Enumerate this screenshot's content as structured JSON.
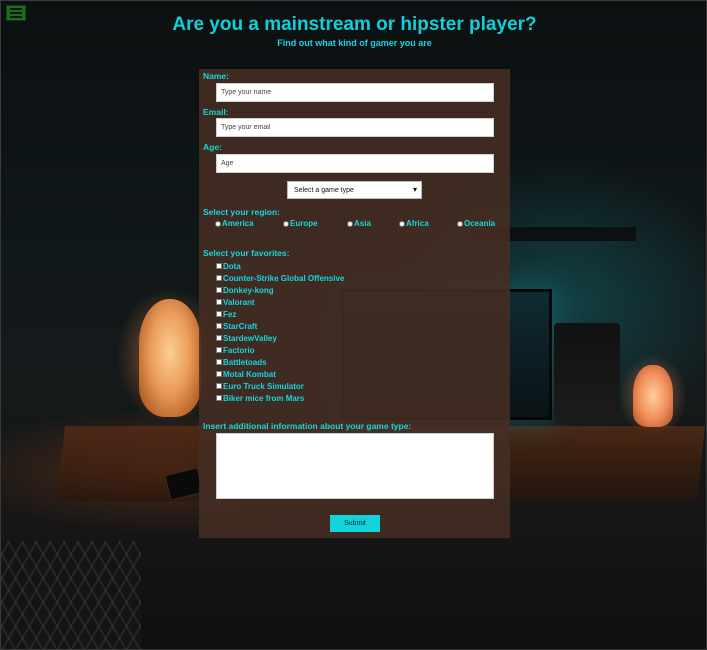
{
  "header": {
    "title": "Are you a mainstream or hipster player?",
    "subtitle": "Find out what kind of gamer you are",
    "menu_icon": "hamburger-menu-icon"
  },
  "form": {
    "name_label": "Name:",
    "name_placeholder": "Type your name",
    "email_label": "Email:",
    "email_placeholder": "Type your email",
    "age_label": "Age:",
    "age_placeholder": "Age",
    "game_type_select": "Select a game type",
    "region_label": "Select your region:",
    "regions": [
      "America",
      "Europe",
      "Asia",
      "Africa",
      "Oceania"
    ],
    "favorites_label": "Select your favorites:",
    "favorites": [
      "Dota",
      "Counter-Strike Global Offensive",
      "Donkey-kong",
      "Valorant",
      "Fez",
      "StarCraft",
      "StardewValley",
      "Factorio",
      "Battletoads",
      "Motal Kombat",
      "Euro Truck Simulator",
      "Biker mice from Mars"
    ],
    "additional_label": "Insert additional information about your game type:",
    "additional_value": "",
    "submit_label": "Submit"
  },
  "colors": {
    "accent": "#16d7de",
    "form_bg": "#46302a",
    "menu_button": "#1f6b1f"
  }
}
